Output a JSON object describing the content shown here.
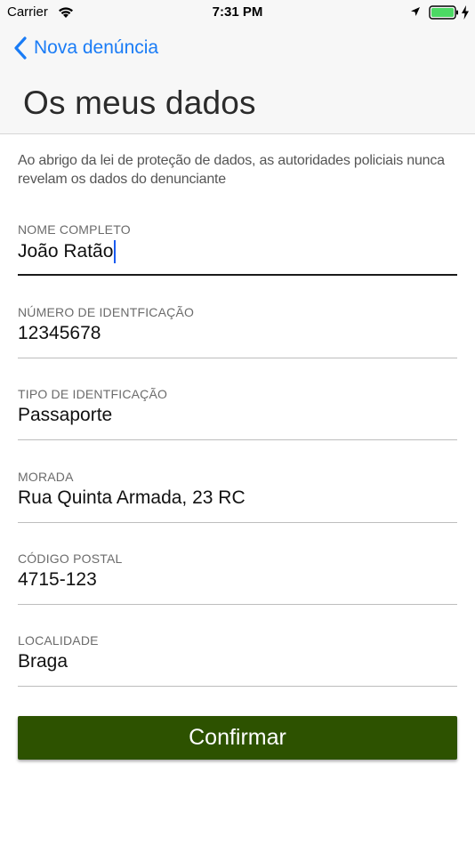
{
  "status_bar": {
    "carrier": "Carrier",
    "time": "7:31 PM",
    "icons": [
      "wifi-icon",
      "location-icon",
      "battery-icon",
      "charge-icon"
    ]
  },
  "nav": {
    "back_label": "Nova denúncia",
    "title": "Os meus dados"
  },
  "intro_text": "Ao abrigo da lei de proteção de dados, as autoridades policiais nunca revelam os dados do denunciante",
  "fields": [
    {
      "label": "NOME COMPLETO",
      "value": "João Ratão"
    },
    {
      "label": "NÚMERO DE IDENTFICAÇÃO",
      "value": "12345678"
    },
    {
      "label": "TIPO DE IDENTFICAÇÃO",
      "value": "Passaporte"
    },
    {
      "label": "MORADA",
      "value": "Rua Quinta Armada, 23 RC"
    },
    {
      "label": "CÓDIGO POSTAL",
      "value": "4715-123"
    },
    {
      "label": "LOCALIDADE",
      "value": "Braga"
    }
  ],
  "confirm_label": "Confirmar",
  "colors": {
    "accent": "#1a7cf6",
    "button": "#2d5200",
    "caret": "#1a5bf0"
  }
}
